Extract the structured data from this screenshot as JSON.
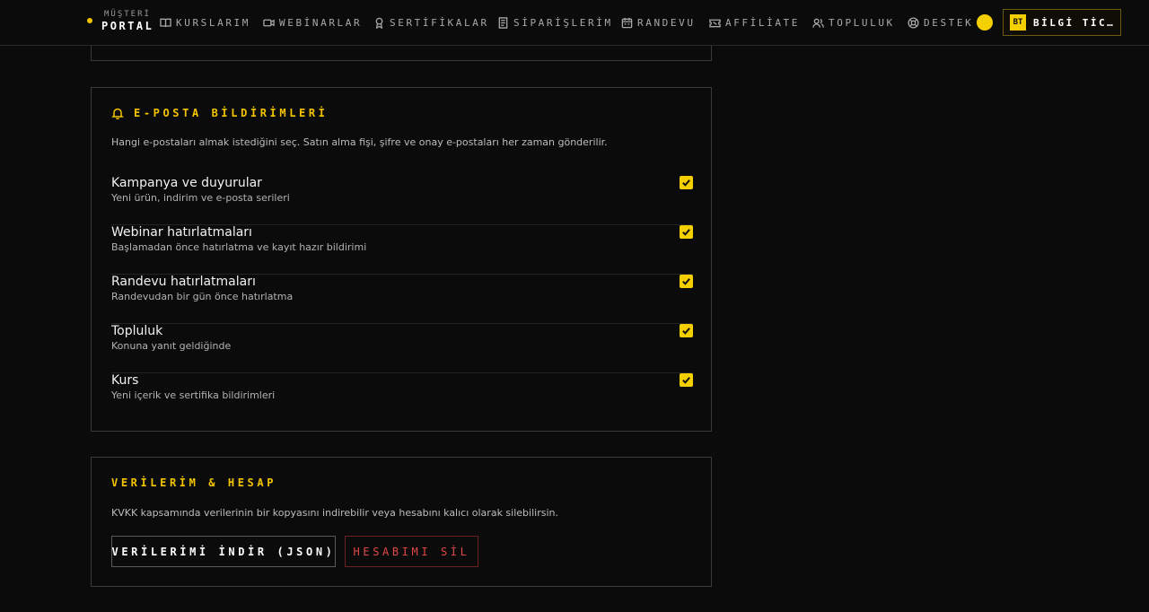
{
  "brand": {
    "small": "MÜŞTERİ",
    "big": "PORTAL"
  },
  "nav": [
    {
      "label": "KURSLARIM",
      "icon": "book-icon"
    },
    {
      "label": "WEBİNARLAR",
      "icon": "video-icon"
    },
    {
      "label": "SERTİFİKALAR",
      "icon": "award-icon"
    },
    {
      "label": "SİPARİŞLERİM",
      "icon": "receipt-icon"
    },
    {
      "label": "RANDEVU",
      "icon": "calendar-icon"
    },
    {
      "label": "AFFİLİATE",
      "icon": "ticket-icon"
    },
    {
      "label": "TOPLULUK",
      "icon": "users-icon"
    },
    {
      "label": "DESTEK",
      "icon": "lifebuoy-icon"
    }
  ],
  "user": {
    "initials": "BT",
    "name": "BİLGİ TİCARET"
  },
  "colors": {
    "accent": "#f4c400",
    "danger": "#e04848",
    "background": "#0b0b0b",
    "border": "#3a3a3a"
  },
  "email_prefs": {
    "heading": "E-POSTA BİLDİRİMLERİ",
    "description": "Hangi e-postaları almak istediğini seç. Satın alma fişi, şifre ve onay e-postaları her zaman gönderilir.",
    "items": [
      {
        "title": "Kampanya ve duyurular",
        "subtitle": "Yeni ürün, indirim ve e-posta serileri",
        "checked": true
      },
      {
        "title": "Webinar hatırlatmaları",
        "subtitle": "Başlamadan önce hatırlatma ve kayıt hazır bildirimi",
        "checked": true
      },
      {
        "title": "Randevu hatırlatmaları",
        "subtitle": "Randevudan bir gün önce hatırlatma",
        "checked": true
      },
      {
        "title": "Topluluk",
        "subtitle": "Konuna yanıt geldiğinde",
        "checked": true
      },
      {
        "title": "Kurs",
        "subtitle": "Yeni içerik ve sertifika bildirimleri",
        "checked": true
      }
    ]
  },
  "data_account": {
    "heading": "VERİLERİM & HESAP",
    "description": "KVKK kapsamında verilerinin bir kopyasını indirebilir veya hesabını kalıcı olarak silebilirsin.",
    "export_label": "VERİLERİMİ İNDİR (JSON)",
    "delete_label": "HESABIMI SİL"
  }
}
